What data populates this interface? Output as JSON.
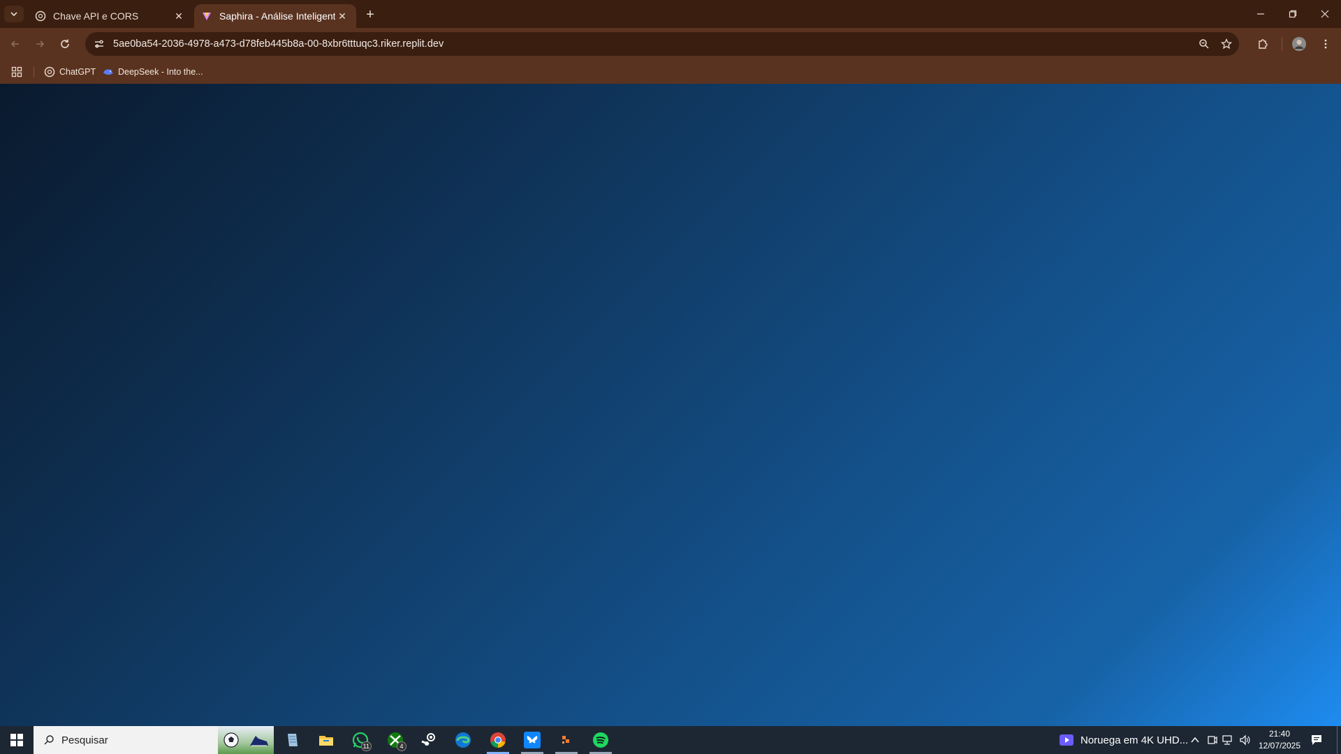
{
  "browser": {
    "tabs": [
      {
        "title": "Chave API e CORS",
        "icon": "chatgpt-icon",
        "active": false
      },
      {
        "title": "Saphira - Análise Inteligente",
        "icon": "saphira-icon",
        "active": true
      }
    ],
    "url": "5ae0ba54-2036-4978-a473-d78feb445b8a-00-8xbr6tttuqc3.riker.replit.dev",
    "bookmarks": [
      {
        "label": "ChatGPT",
        "icon": "chatgpt-icon"
      },
      {
        "label": "DeepSeek - Into the...",
        "icon": "deepseek-icon"
      }
    ],
    "colors": {
      "tabbar": "#3a1e10",
      "toolbar": "#5a3320"
    }
  },
  "page": {
    "background": "blue-gradient"
  },
  "taskbar": {
    "search_placeholder": "Pesquisar",
    "apps": [
      {
        "name": "notepad-icon"
      },
      {
        "name": "file-explorer-icon"
      },
      {
        "name": "whatsapp-icon",
        "badge": "11"
      },
      {
        "name": "xbox-icon",
        "badge": "4"
      },
      {
        "name": "steam-icon"
      },
      {
        "name": "edge-icon"
      },
      {
        "name": "chrome-icon",
        "state": "active"
      },
      {
        "name": "bluesky-icon",
        "state": "running"
      },
      {
        "name": "unknown-app-icon",
        "state": "running"
      },
      {
        "name": "spotify-icon",
        "state": "running"
      }
    ],
    "media": "Noruega em 4K UHD...",
    "time": "21:40",
    "date": "12/07/2025"
  }
}
